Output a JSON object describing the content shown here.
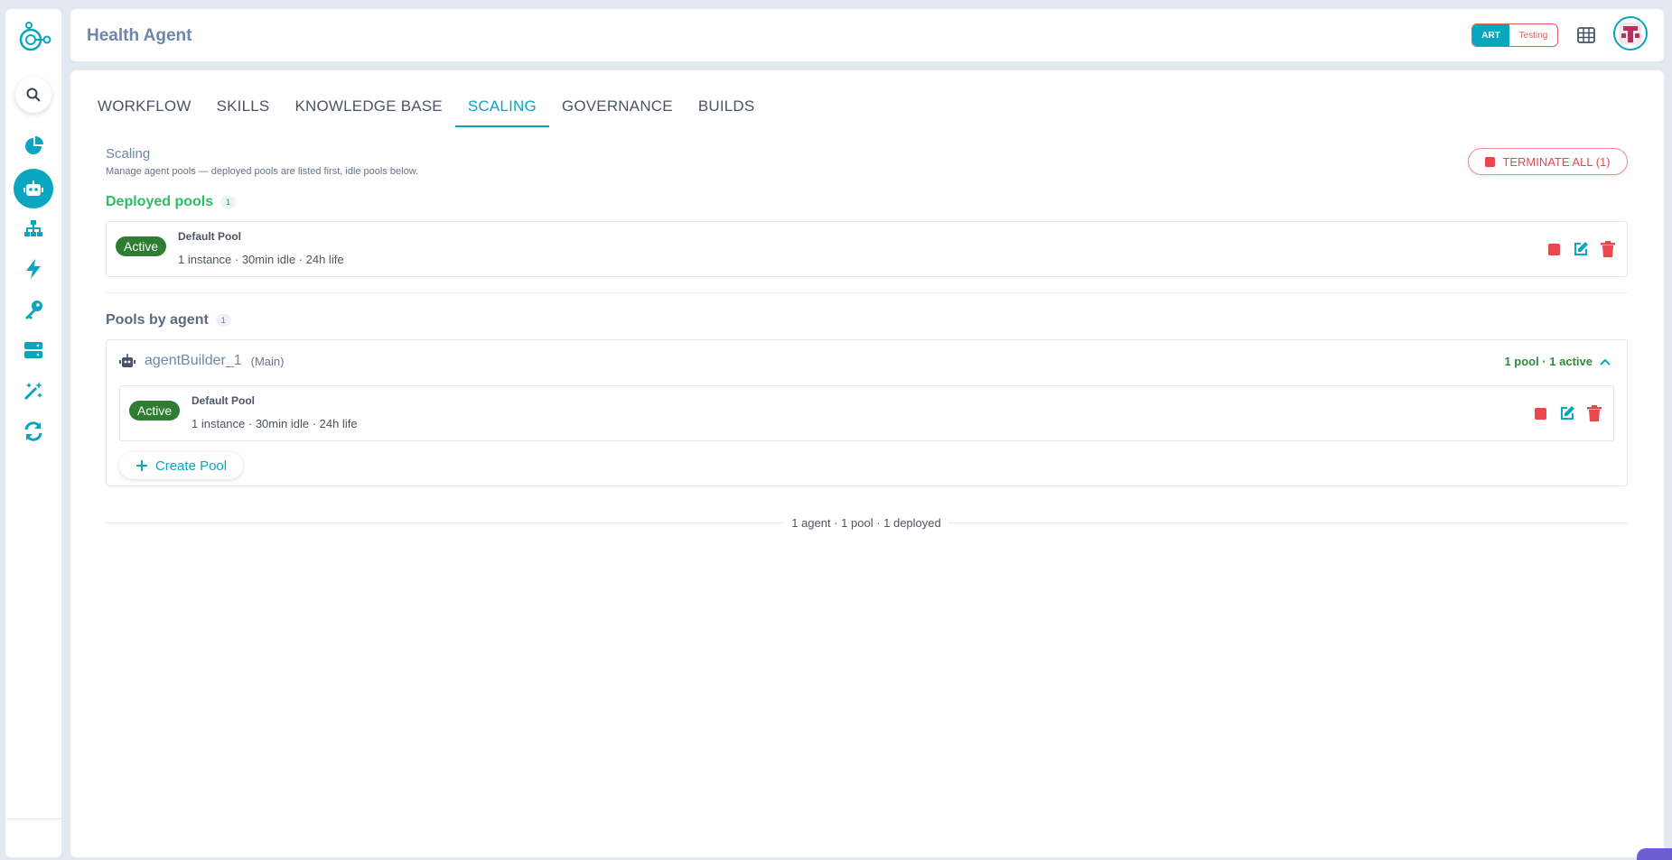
{
  "header": {
    "title": "Health Agent",
    "env_art": "ART",
    "env_testing": "Testing"
  },
  "tabs": [
    {
      "label": "WORKFLOW"
    },
    {
      "label": "SKILLS"
    },
    {
      "label": "KNOWLEDGE BASE"
    },
    {
      "label": "SCALING",
      "active": true
    },
    {
      "label": "GOVERNANCE"
    },
    {
      "label": "BUILDS"
    }
  ],
  "scaling": {
    "title": "Scaling",
    "subtitle": "Manage agent pools — deployed pools are listed first, idle pools below.",
    "terminate_label": "TERMINATE ALL (1)"
  },
  "deployed": {
    "title": "Deployed pools",
    "count": "1",
    "pool": {
      "status": "Active",
      "name": "Default Pool",
      "meta": "1 instance · 30min idle · 24h life"
    }
  },
  "by_agent": {
    "title": "Pools by agent",
    "count": "1",
    "agent": {
      "name": "agentBuilder_1",
      "tag": "(Main)",
      "summary": "1 pool · 1 active",
      "pool": {
        "status": "Active",
        "name": "Default Pool",
        "meta": "1 instance · 30min idle · 24h life"
      },
      "create_label": "Create Pool"
    }
  },
  "footer": {
    "summary": "1 agent · 1 pool · 1 deployed"
  },
  "colors": {
    "accent": "#0aa5bf",
    "danger": "#e8474e",
    "success": "#2e7d32"
  }
}
